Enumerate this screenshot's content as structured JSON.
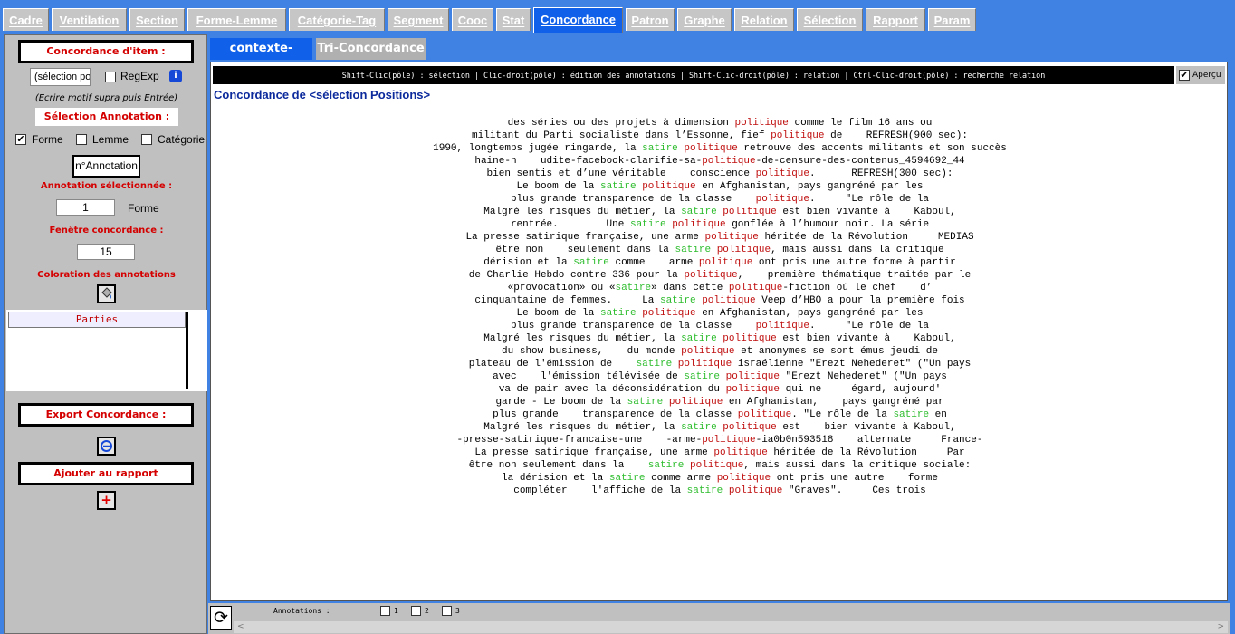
{
  "tabs": [
    {
      "label": "Cadre"
    },
    {
      "label": "Ventilation"
    },
    {
      "label": "Section"
    },
    {
      "label": "Forme-Lemme"
    },
    {
      "label": "Catégorie-Tag"
    },
    {
      "label": "Segment"
    },
    {
      "label": "Cooc"
    },
    {
      "label": "Stat"
    },
    {
      "label": "Concordance"
    },
    {
      "label": "Patron"
    },
    {
      "label": "Graphe"
    },
    {
      "label": "Relation"
    },
    {
      "label": "Sélection"
    },
    {
      "label": "Rapport"
    },
    {
      "label": "Param"
    }
  ],
  "active_tab": "Concordance",
  "sidebar": {
    "concordance_item_label": "Concordance d'item :",
    "search_value": "(sélection po",
    "regexp_label": "RegExp",
    "info_icon": "i",
    "hint": "(Ecrire motif supra puis Entrée)",
    "selection_annotation_label": "Sélection Annotation :",
    "forme_label": "Forme",
    "lemme_label": "Lemme",
    "categorie_label": "Catégorie",
    "forme_checked": "✔",
    "num_annotation_button": "n°Annotation",
    "annotation_selected_label": "Annotation sélectionnée :",
    "annotation_value": "1",
    "annotation_type": "Forme",
    "window_label": "Fenêtre concordance :",
    "window_value": "15",
    "coloration_label": "Coloration des annotations",
    "parties_header": "Parties",
    "export_label": "Export Concordance :",
    "add_report_label": "Ajouter au rapport",
    "add_icon": "+"
  },
  "subtabs": [
    {
      "label": "contexte-partie"
    },
    {
      "label": "Tri-Concordance"
    }
  ],
  "main": {
    "hint": "Shift-Clic(pôle) : sélection | Clic-droit(pôle) : édition des annotations | Shift-Clic-droit(pôle) : relation | Ctrl-Clic-droit(pôle) : recherche relation",
    "apercu_label": "Aperçu",
    "apercu_checked": "✔",
    "title": "Concordance de <sélection Positions>"
  },
  "concordance_lines": [
    [
      [
        "t",
        "des séries ou des projets à dimension "
      ],
      [
        "p",
        "politique"
      ],
      [
        "t",
        " comme le film 16 ans ou"
      ]
    ],
    [
      [
        "t",
        "militant du Parti socialiste dans l’Essonne, fief "
      ],
      [
        "p",
        "politique"
      ],
      [
        "t",
        " de    REFRESH(900 sec):"
      ]
    ],
    [
      [
        "t",
        "1990, longtemps jugée ringarde, la "
      ],
      [
        "s",
        "satire"
      ],
      [
        "t",
        " "
      ],
      [
        "p",
        "politique"
      ],
      [
        "t",
        " retrouve des accents militants et son succès"
      ]
    ],
    [
      [
        "t",
        "haine-n    udite-facebook-clarifie-sa-"
      ],
      [
        "p",
        "politique"
      ],
      [
        "t",
        "-de-censure-des-contenus_4594692_44"
      ]
    ],
    [
      [
        "t",
        "bien sentis et d’une véritable    conscience "
      ],
      [
        "p",
        "politique"
      ],
      [
        "t",
        ".      REFRESH(300 sec):"
      ]
    ],
    [
      [
        "t",
        "Le boom de la "
      ],
      [
        "s",
        "satire"
      ],
      [
        "t",
        " "
      ],
      [
        "p",
        "politique"
      ],
      [
        "t",
        " en Afghanistan, pays gangréné par les"
      ]
    ],
    [
      [
        "t",
        "plus grande transparence de la classe    "
      ],
      [
        "p",
        "politique"
      ],
      [
        "t",
        ".     \"Le rôle de la"
      ]
    ],
    [
      [
        "t",
        "Malgré les risques du métier, la "
      ],
      [
        "s",
        "satire"
      ],
      [
        "t",
        " "
      ],
      [
        "p",
        "politique"
      ],
      [
        "t",
        " est bien vivante à    Kaboul,"
      ]
    ],
    [
      [
        "t",
        "rentrée.        Une "
      ],
      [
        "s",
        "satire"
      ],
      [
        "t",
        " "
      ],
      [
        "p",
        "politique"
      ],
      [
        "t",
        " gonflée à l’humour noir. La série"
      ]
    ],
    [
      [
        "t",
        "La presse satirique française, une arme "
      ],
      [
        "p",
        "politique"
      ],
      [
        "t",
        " héritée de la Révolution     MEDIAS"
      ]
    ],
    [
      [
        "t",
        "être non    seulement dans la "
      ],
      [
        "s",
        "satire"
      ],
      [
        "t",
        " "
      ],
      [
        "p",
        "politique"
      ],
      [
        "t",
        ", mais aussi dans la critique"
      ]
    ],
    [
      [
        "t",
        "dérision et la "
      ],
      [
        "s",
        "satire"
      ],
      [
        "t",
        " comme    arme "
      ],
      [
        "p",
        "politique"
      ],
      [
        "t",
        " ont pris une autre forme à partir"
      ]
    ],
    [
      [
        "t",
        "de Charlie Hebdo contre 336 pour la "
      ],
      [
        "p",
        "politique"
      ],
      [
        "t",
        ",    première thématique traitée par le"
      ]
    ],
    [
      [
        "t",
        "«provocation» ou «"
      ],
      [
        "s",
        "satire"
      ],
      [
        "t",
        "» dans cette "
      ],
      [
        "p",
        "politique"
      ],
      [
        "t",
        "-fiction où le chef    d’"
      ]
    ],
    [
      [
        "t",
        "cinquantaine de femmes.     La "
      ],
      [
        "s",
        "satire"
      ],
      [
        "t",
        " "
      ],
      [
        "p",
        "politique"
      ],
      [
        "t",
        " Veep d’HBO a pour la première fois"
      ]
    ],
    [
      [
        "t",
        "Le boom de la "
      ],
      [
        "s",
        "satire"
      ],
      [
        "t",
        " "
      ],
      [
        "p",
        "politique"
      ],
      [
        "t",
        " en Afghanistan, pays gangréné par les"
      ]
    ],
    [
      [
        "t",
        "plus grande transparence de la classe    "
      ],
      [
        "p",
        "politique"
      ],
      [
        "t",
        ".     \"Le rôle de la"
      ]
    ],
    [
      [
        "t",
        "Malgré les risques du métier, la "
      ],
      [
        "s",
        "satire"
      ],
      [
        "t",
        " "
      ],
      [
        "p",
        "politique"
      ],
      [
        "t",
        " est bien vivante à    Kaboul,"
      ]
    ],
    [
      [
        "t",
        "du show business,    du monde "
      ],
      [
        "p",
        "politique"
      ],
      [
        "t",
        " et anonymes se sont émus jeudi de"
      ]
    ],
    [
      [
        "t",
        "plateau de l'émission de    "
      ],
      [
        "s",
        "satire"
      ],
      [
        "t",
        " "
      ],
      [
        "p",
        "politique"
      ],
      [
        "t",
        " israélienne \"Erezt Nehederet\" (\"Un pays"
      ]
    ],
    [
      [
        "t",
        "avec    l'émission télévisée de "
      ],
      [
        "s",
        "satire"
      ],
      [
        "t",
        " "
      ],
      [
        "p",
        "politique"
      ],
      [
        "t",
        " \"Erezt Nehederet\" (\"Un pays"
      ]
    ],
    [
      [
        "t",
        "va de pair avec la déconsidération du "
      ],
      [
        "p",
        "politique"
      ],
      [
        "t",
        " qui ne     égard, aujourd'"
      ]
    ],
    [
      [
        "t",
        "garde - Le boom de la "
      ],
      [
        "s",
        "satire"
      ],
      [
        "t",
        " "
      ],
      [
        "p",
        "politique"
      ],
      [
        "t",
        " en Afghanistan,    pays gangréné par"
      ]
    ],
    [
      [
        "t",
        "plus grande    transparence de la classe "
      ],
      [
        "p",
        "politique"
      ],
      [
        "t",
        ". \"Le rôle de la "
      ],
      [
        "s",
        "satire"
      ],
      [
        "t",
        " en"
      ]
    ],
    [
      [
        "t",
        "Malgré les risques du métier, la "
      ],
      [
        "s",
        "satire"
      ],
      [
        "t",
        " "
      ],
      [
        "p",
        "politique"
      ],
      [
        "t",
        " est    bien vivante à Kaboul,"
      ]
    ],
    [
      [
        "t",
        "-presse-satirique-francaise-une    -arme-"
      ],
      [
        "p",
        "politique"
      ],
      [
        "t",
        "-ia0b0n593518    alternate     France-"
      ]
    ],
    [
      [
        "t",
        "La presse satirique française, une arme "
      ],
      [
        "p",
        "politique"
      ],
      [
        "t",
        " héritée de la Révolution     Par"
      ]
    ],
    [
      [
        "t",
        "être non seulement dans la    "
      ],
      [
        "s",
        "satire"
      ],
      [
        "t",
        " "
      ],
      [
        "p",
        "politique"
      ],
      [
        "t",
        ", mais aussi dans la critique sociale:"
      ]
    ],
    [
      [
        "t",
        "la dérision et la "
      ],
      [
        "s",
        "satire"
      ],
      [
        "t",
        " comme arme "
      ],
      [
        "p",
        "politique"
      ],
      [
        "t",
        " ont pris une autre    forme"
      ]
    ],
    [
      [
        "t",
        "compléter    l'affiche de la "
      ],
      [
        "s",
        "satire"
      ],
      [
        "t",
        " "
      ],
      [
        "p",
        "politique"
      ],
      [
        "t",
        " \"Graves\".     Ces trois"
      ]
    ]
  ],
  "bottom": {
    "annotations_label": "Annotations :",
    "annot1": "1",
    "annot2": "2",
    "annot3": "3",
    "refresh_icon": "⟳",
    "scroll_left": "<",
    "scroll_right": ">"
  },
  "colors": {
    "accent": "#1060ea",
    "pole": "#c01010",
    "cooc": "#2ebd2e",
    "title": "#0c2a9c"
  }
}
